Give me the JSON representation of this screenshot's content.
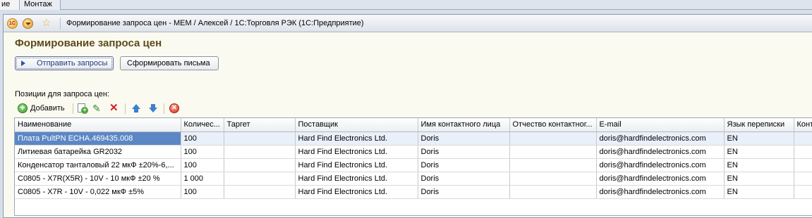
{
  "tabs": [
    {
      "label": "ие"
    },
    {
      "label": "Монтаж"
    }
  ],
  "window": {
    "title": "Формирование запроса цен - МЕМ / Алексей / 1С:Торговля РЭК  (1С:Предприятие)",
    "logo_text": "1С"
  },
  "form": {
    "title": "Формирование запроса цен",
    "send_button": "Отправить запросы",
    "letters_button": "Сформировать письма",
    "section_label": "Позиции для запроса цен:"
  },
  "toolbar": {
    "add_label": "Добавить",
    "icons": [
      "add-icon",
      "copy-icon",
      "edit-icon",
      "delete-icon",
      "move-up-icon",
      "move-down-icon",
      "cancel-icon"
    ]
  },
  "table": {
    "columns": [
      "Наименование",
      "Количес...",
      "Таргет",
      "Поставщик",
      "Имя контактного лица",
      "Отчество контактног...",
      "E-mail",
      "Язык переписки",
      "Конт"
    ],
    "rows": [
      [
        "Плата PultPN    ECHA.469435.008",
        "100",
        "",
        "Hard Find Electronics Ltd.",
        "Doris",
        "",
        "doris@hardfindelectronics.com",
        "EN",
        ""
      ],
      [
        "Литиевая батарейка GR2032",
        "100",
        "",
        "Hard Find Electronics Ltd.",
        "Doris",
        "",
        "doris@hardfindelectronics.com",
        "EN",
        ""
      ],
      [
        "Конденсатор танталовый 22 мкФ ±20%-6,...",
        "100",
        "",
        "Hard Find Electronics Ltd.",
        "Doris",
        "",
        "doris@hardfindelectronics.com",
        "EN",
        ""
      ],
      [
        "C0805 - X7R(X5R) - 10V - 10 мкФ ±20 %",
        "1 000",
        "",
        "Hard Find Electronics Ltd.",
        "Doris",
        "",
        "doris@hardfindelectronics.com",
        "EN",
        ""
      ],
      [
        "C0805 - X7R - 10V - 0,022 мкФ ±5%",
        "100",
        "",
        "Hard Find Electronics Ltd.",
        "Doris",
        "",
        "doris@hardfindelectronics.com",
        "EN",
        ""
      ]
    ],
    "selected_row": 0
  }
}
